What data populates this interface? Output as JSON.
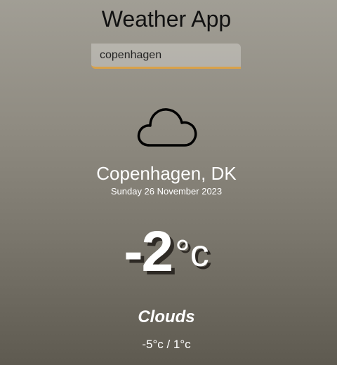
{
  "app": {
    "title": "Weather App"
  },
  "search": {
    "value": "copenhagen",
    "accent_color": "#d9a24a"
  },
  "weather": {
    "icon": "cloud-icon",
    "location": "Copenhagen, DK",
    "date": "Sunday 26 November 2023",
    "temperature": "-2",
    "unit": "°c",
    "condition": "Clouds",
    "range": "-5°c / 1°c"
  }
}
